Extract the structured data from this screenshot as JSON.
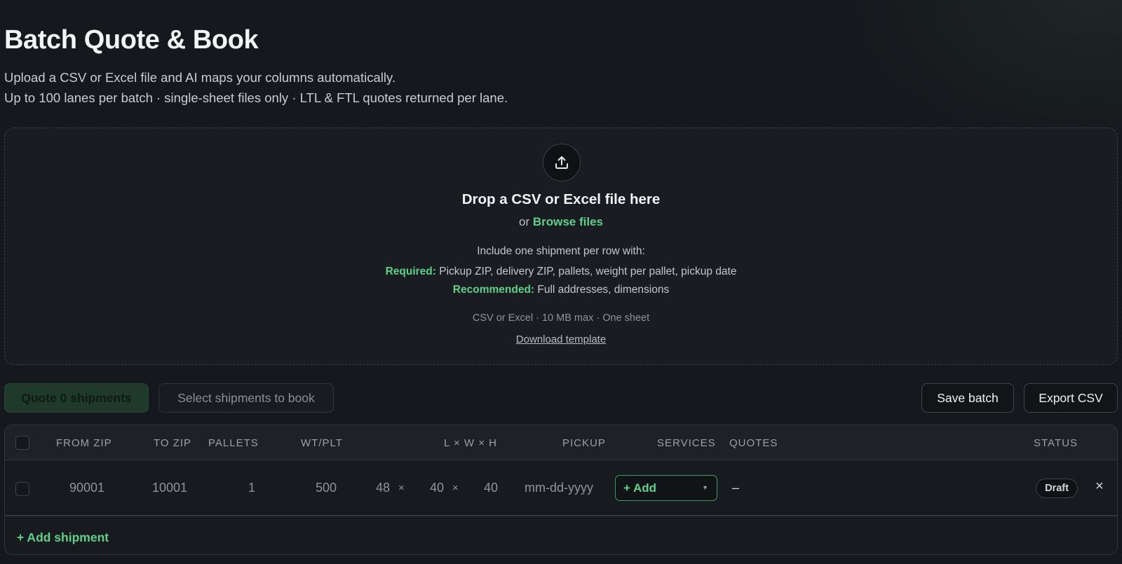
{
  "header": {
    "title": "Batch Quote & Book",
    "subtitle_line1": "Upload a CSV or Excel file and AI maps your columns automatically.",
    "subtitle_line2": "Up to 100 lanes per batch · single-sheet files only · LTL & FTL quotes returned per lane."
  },
  "dropzone": {
    "icon": "upload-icon",
    "headline": "Drop a CSV or Excel file here",
    "or_text": "or",
    "browse_label": "Browse files",
    "include_text": "Include one shipment per row with:",
    "required_label": "Required:",
    "required_text": "Pickup ZIP, delivery ZIP, pallets, weight per pallet, pickup date",
    "recommended_label": "Recommended:",
    "recommended_text": "Full addresses, dimensions",
    "limits_text": "CSV or Excel · 10 MB max · One sheet",
    "template_link": "Download template"
  },
  "toolbar": {
    "quote_label": "Quote 0 shipments",
    "select_label": "Select shipments to book",
    "save_label": "Save batch",
    "export_label": "Export CSV"
  },
  "table": {
    "columns": {
      "from_zip": "FROM ZIP",
      "to_zip": "TO ZIP",
      "pallets": "PALLETS",
      "wt_plt": "WT/PLT",
      "dims": "L × W × H",
      "pickup": "PICKUP",
      "services": "SERVICES",
      "quotes": "QUOTES",
      "status": "STATUS"
    },
    "rows": [
      {
        "from_zip": "90001",
        "to_zip": "10001",
        "pallets": "1",
        "weight": "500",
        "length": "48",
        "width": "40",
        "height": "40",
        "times": "×",
        "pickup_placeholder": "mm-dd-yyyy",
        "services_label": "+ Add",
        "quotes": "–",
        "status": "Draft",
        "remove": "×"
      }
    ],
    "add_shipment_label": "+ Add shipment"
  },
  "colors": {
    "accent_green": "#5fd08a",
    "background": "#15181c"
  }
}
